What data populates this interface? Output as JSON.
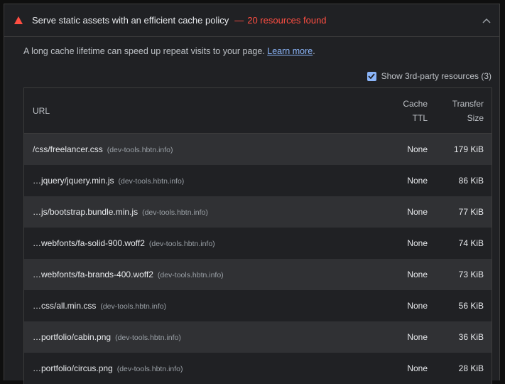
{
  "header": {
    "title": "Serve static assets with an efficient cache policy",
    "separator": "—",
    "count": "20 resources found",
    "warn_color": "#ff4e42"
  },
  "description": {
    "text": "A long cache lifetime can speed up repeat visits to your page. ",
    "link": "Learn more",
    "suffix": "."
  },
  "third_party": {
    "label": "Show 3rd-party resources (3)",
    "checked": true
  },
  "table": {
    "headers": {
      "url": "URL",
      "ttl_1": "Cache",
      "ttl_2": "TTL",
      "size_1": "Transfer",
      "size_2": "Size"
    },
    "rows": [
      {
        "url": "/css/freelancer.css",
        "host": "(dev-tools.hbtn.info)",
        "ttl": "None",
        "size": "179 KiB"
      },
      {
        "url": "…jquery/jquery.min.js",
        "host": "(dev-tools.hbtn.info)",
        "ttl": "None",
        "size": "86 KiB"
      },
      {
        "url": "…js/bootstrap.bundle.min.js",
        "host": "(dev-tools.hbtn.info)",
        "ttl": "None",
        "size": "77 KiB"
      },
      {
        "url": "…webfonts/fa-solid-900.woff2",
        "host": "(dev-tools.hbtn.info)",
        "ttl": "None",
        "size": "74 KiB"
      },
      {
        "url": "…webfonts/fa-brands-400.woff2",
        "host": "(dev-tools.hbtn.info)",
        "ttl": "None",
        "size": "73 KiB"
      },
      {
        "url": "…css/all.min.css",
        "host": "(dev-tools.hbtn.info)",
        "ttl": "None",
        "size": "56 KiB"
      },
      {
        "url": "…portfolio/cabin.png",
        "host": "(dev-tools.hbtn.info)",
        "ttl": "None",
        "size": "36 KiB"
      },
      {
        "url": "…portfolio/circus.png",
        "host": "(dev-tools.hbtn.info)",
        "ttl": "None",
        "size": "28 KiB"
      }
    ]
  },
  "icons": {
    "warning": "warning-triangle-icon",
    "collapse": "chevron-up-icon",
    "checkbox": "checkmark-icon"
  }
}
